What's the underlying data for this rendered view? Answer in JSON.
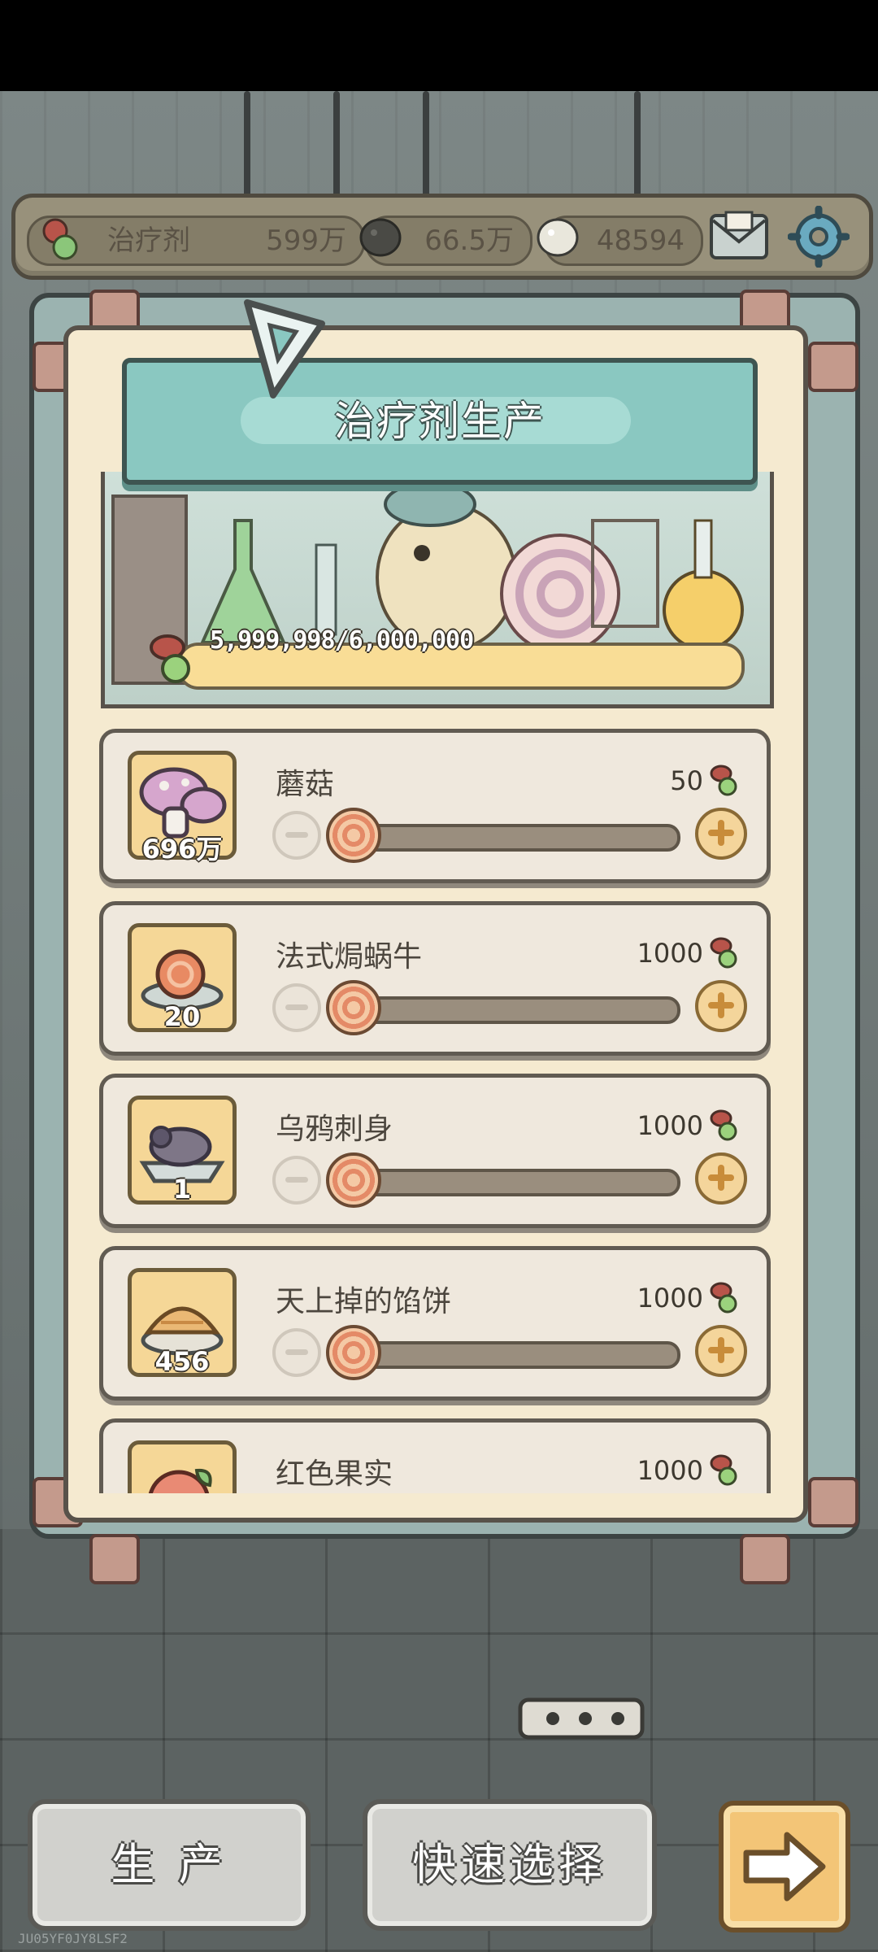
{
  "resources": [
    {
      "icon": "potion-mushroom-icon",
      "label": "治疗剂",
      "value": "599万"
    },
    {
      "icon": "dark-bubble-icon",
      "label": "",
      "value": "66.5万"
    },
    {
      "icon": "light-bubble-icon",
      "label": "",
      "value": "48594"
    }
  ],
  "header": {
    "mail_icon": "mail-icon",
    "settings_icon": "gear-icon"
  },
  "panel": {
    "title": "治疗剂生产",
    "progress_text": "5,999,998/6,000,000",
    "progress_fraction": 0.99999967
  },
  "items": [
    {
      "name": "蘑菇",
      "count": "696万",
      "cost": "50",
      "icon": "mushroom-icon"
    },
    {
      "name": "法式焗蜗牛",
      "count": "20",
      "cost": "1000",
      "icon": "escargot-icon"
    },
    {
      "name": "乌鸦刺身",
      "count": "1",
      "cost": "1000",
      "icon": "crow-sashimi-icon"
    },
    {
      "name": "天上掉的馅饼",
      "count": "456",
      "cost": "1000",
      "icon": "pie-icon"
    },
    {
      "name": "红色果实",
      "count": "",
      "cost": "1000",
      "icon": "red-fruit-icon"
    }
  ],
  "buttons": {
    "produce": "生 产",
    "quick_select": "快速选择",
    "next_icon": "arrow-right-icon"
  },
  "watermark": "JU05YF0JY8LSF2"
}
